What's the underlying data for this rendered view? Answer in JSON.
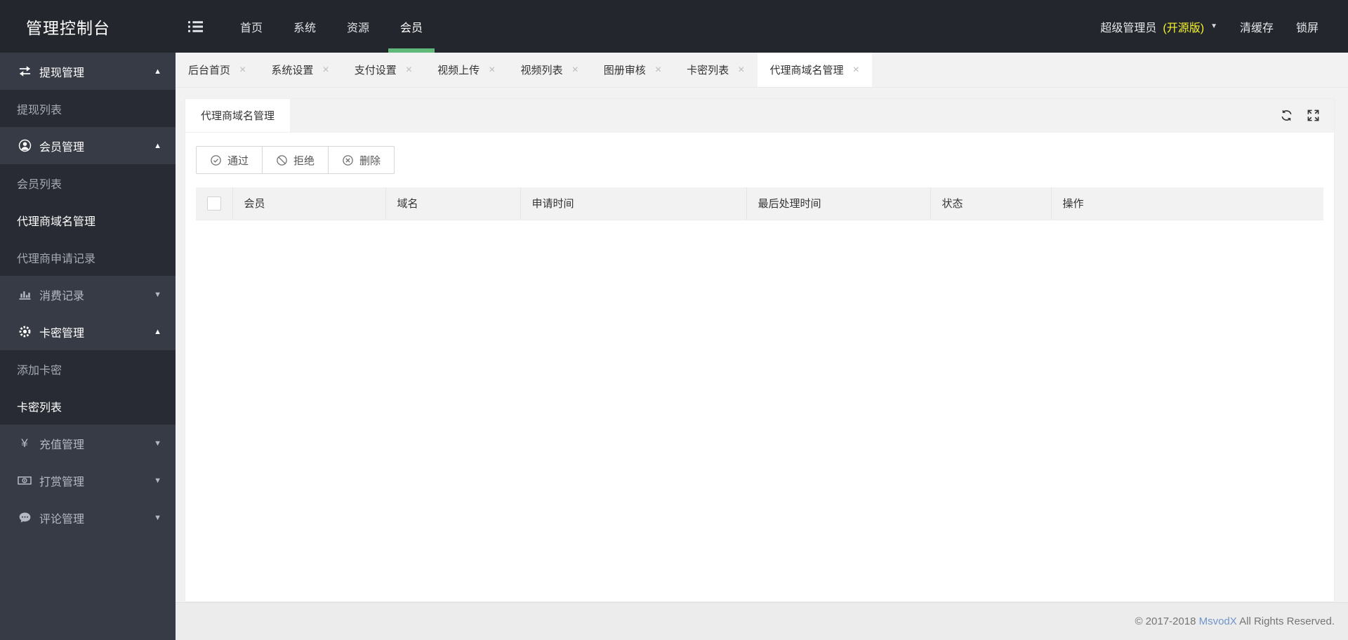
{
  "colors": {
    "accent_green": "#5FB878",
    "badge_yellow": "#f6f52d",
    "link_blue": "#6f95cc"
  },
  "header": {
    "title": "管理控制台",
    "nav": [
      {
        "name": "home",
        "label": "首页",
        "active": false
      },
      {
        "name": "system",
        "label": "系统",
        "active": false
      },
      {
        "name": "resource",
        "label": "资源",
        "active": false
      },
      {
        "name": "member",
        "label": "会员",
        "active": true
      }
    ],
    "user": {
      "name": "超级管理员",
      "badge": "(开源版)"
    },
    "actions": [
      {
        "name": "clear-cache",
        "label": "清缓存"
      },
      {
        "name": "lock-screen",
        "label": "锁屏"
      }
    ]
  },
  "sidebar": {
    "sections": [
      {
        "name": "withdraw",
        "icon": "swap-icon",
        "label": "提现管理",
        "expanded": true,
        "children": [
          {
            "name": "withdraw-list",
            "label": "提现列表",
            "active": false
          }
        ]
      },
      {
        "name": "member",
        "icon": "user-circle-icon",
        "label": "会员管理",
        "expanded": true,
        "children": [
          {
            "name": "member-list",
            "label": "会员列表",
            "active": false
          },
          {
            "name": "agent-domain-manage",
            "label": "代理商域名管理",
            "active": true
          },
          {
            "name": "agent-apply-record",
            "label": "代理商申请记录",
            "active": false
          }
        ]
      },
      {
        "name": "consume-record",
        "icon": "bar-chart-icon",
        "label": "消费记录",
        "expanded": false,
        "children": []
      },
      {
        "name": "cardkey",
        "icon": "gear-icon",
        "label": "卡密管理",
        "expanded": true,
        "children": [
          {
            "name": "add-cardkey",
            "label": "添加卡密",
            "active": false
          },
          {
            "name": "cardkey-list",
            "label": "卡密列表",
            "active": true
          }
        ]
      },
      {
        "name": "recharge",
        "icon": "yen-icon",
        "label": "充值管理",
        "expanded": false,
        "children": []
      },
      {
        "name": "reward",
        "icon": "banknote-icon",
        "label": "打赏管理",
        "expanded": false,
        "children": []
      },
      {
        "name": "comment",
        "icon": "comment-icon",
        "label": "评论管理",
        "expanded": false,
        "children": []
      }
    ]
  },
  "tabs": {
    "items": [
      {
        "name": "home",
        "label": "后台首页"
      },
      {
        "name": "system-settings",
        "label": "系统设置"
      },
      {
        "name": "payment-settings",
        "label": "支付设置"
      },
      {
        "name": "video-upload",
        "label": "视频上传"
      },
      {
        "name": "video-list",
        "label": "视频列表"
      },
      {
        "name": "album-review",
        "label": "图册审核"
      },
      {
        "name": "cardkey-list",
        "label": "卡密列表"
      },
      {
        "name": "agent-domain-manage",
        "label": "代理商域名管理"
      }
    ],
    "active_index": 7,
    "close_glyph": "×"
  },
  "panel": {
    "title": "代理商域名管理",
    "icons": [
      {
        "name": "refresh",
        "icon": "refresh-icon"
      },
      {
        "name": "fullscreen",
        "icon": "fullscreen-icon"
      }
    ]
  },
  "toolbar": {
    "buttons": [
      {
        "name": "approve",
        "icon": "check-circle-icon",
        "label": "通过"
      },
      {
        "name": "reject",
        "icon": "ban-circle-icon",
        "label": "拒绝"
      },
      {
        "name": "delete",
        "icon": "x-circle-icon",
        "label": "删除"
      }
    ]
  },
  "table": {
    "columns": [
      {
        "name": "member",
        "label": "会员"
      },
      {
        "name": "domain",
        "label": "域名"
      },
      {
        "name": "apply-time",
        "label": "申请时间"
      },
      {
        "name": "handle-time",
        "label": "最后处理时间"
      },
      {
        "name": "status",
        "label": "状态"
      },
      {
        "name": "operation",
        "label": "操作"
      }
    ],
    "rows": []
  },
  "footer": {
    "copyright": "© 2017-2018 ",
    "link": "MsvodX",
    "suffix": " All Rights Reserved."
  }
}
